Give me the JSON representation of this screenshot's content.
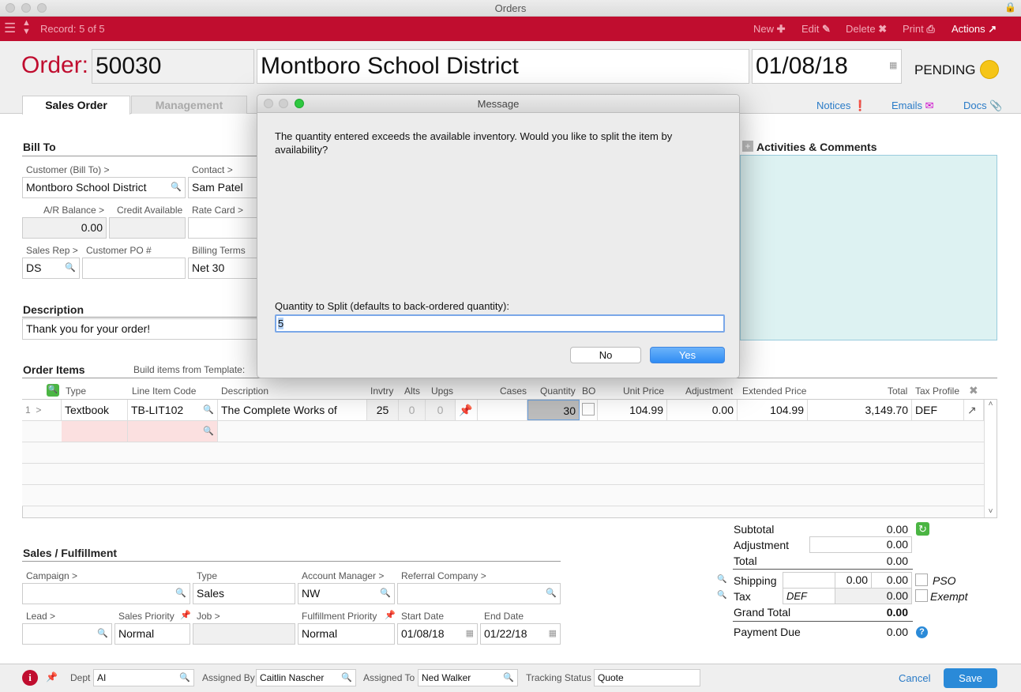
{
  "window": {
    "title": "Orders"
  },
  "toolbar": {
    "record": "Record: 5 of 5",
    "new": "New",
    "edit": "Edit",
    "delete": "Delete",
    "print": "Print",
    "actions": "Actions"
  },
  "header": {
    "order_label": "Order:",
    "order_number": "50030",
    "customer_name": "Montboro School District",
    "date": "01/08/18",
    "status": "PENDING",
    "status_color": "#f5c518"
  },
  "tabs": [
    "Sales Order",
    "Management"
  ],
  "links": {
    "notices": "Notices",
    "emails": "Emails",
    "docs": "Docs"
  },
  "bill_to": {
    "title": "Bill To",
    "customer_label": "Customer (Bill To) >",
    "customer": "Montboro School District",
    "contact_label": "Contact >",
    "contact": "Sam Patel",
    "ar_label": "A/R Balance >",
    "ar": "0.00",
    "credit_label": "Credit Available",
    "credit": "",
    "rate_label": "Rate Card >",
    "rate": "",
    "rep_label": "Sales Rep >",
    "rep": "DS",
    "po_label": "Customer PO #",
    "po": "",
    "terms_label": "Billing Terms",
    "terms": "Net 30"
  },
  "description": {
    "title": "Description",
    "value": "Thank you for your order!"
  },
  "activities": {
    "title": "Activities & Comments"
  },
  "order_items": {
    "title": "Order Items",
    "template_label": "Build items from Template:",
    "columns": [
      "Type",
      "Line Item Code",
      "Description",
      "Invtry",
      "Alts",
      "Upgs",
      "Cases",
      "Quantity",
      "BO",
      "Unit Price",
      "Adjustment",
      "Extended Price",
      "Total",
      "Tax Profile"
    ],
    "rows": [
      {
        "num": "1",
        "type": "Textbook",
        "code": "TB-LIT102",
        "description": "The Complete Works of",
        "invtry": "25",
        "alts": "0",
        "upgs": "0",
        "cases": "",
        "quantity": "30",
        "unit_price": "104.99",
        "adjustment": "0.00",
        "extended": "104.99",
        "total": "3,149.70",
        "tax": "DEF"
      }
    ]
  },
  "totals": {
    "subtotal_label": "Subtotal",
    "subtotal": "0.00",
    "adjustment_label": "Adjustment",
    "adjustment": "0.00",
    "total_label": "Total",
    "total": "0.00",
    "shipping_label": "Shipping",
    "shipping_a": "0.00",
    "shipping_b": "0.00",
    "pso": "PSO",
    "tax_label": "Tax",
    "tax_profile": "DEF",
    "tax": "0.00",
    "exempt": "Exempt",
    "grand_label": "Grand Total",
    "grand": "0.00",
    "due_label": "Payment Due",
    "due": "0.00"
  },
  "fulfillment": {
    "title": "Sales / Fulfillment",
    "campaign_label": "Campaign >",
    "campaign": "",
    "type_label": "Type",
    "type": "Sales",
    "am_label": "Account Manager >",
    "am": "NW",
    "ref_label": "Referral Company >",
    "ref": "",
    "lead_label": "Lead >",
    "lead": "",
    "priority_label": "Sales Priority",
    "priority": "Normal",
    "job_label": "Job >",
    "job": "",
    "fp_label": "Fulfillment Priority",
    "fp": "Normal",
    "start_label": "Start Date",
    "start": "01/08/18",
    "end_label": "End Date",
    "end": "01/22/18"
  },
  "bottom": {
    "dept_label": "Dept",
    "dept": "AI",
    "assigned_by_label": "Assigned By",
    "assigned_by": "Caitlin Nascher",
    "assigned_to_label": "Assigned To",
    "assigned_to": "Ned Walker",
    "tracking_label": "Tracking Status",
    "tracking": "Quote",
    "cancel": "Cancel",
    "save": "Save"
  },
  "dialog": {
    "title": "Message",
    "message": "The quantity entered exceeds the available inventory. Would you like to split the item by availability?",
    "qty_label": "Quantity to Split (defaults to back-ordered quantity):",
    "qty": "5",
    "no": "No",
    "yes": "Yes"
  }
}
